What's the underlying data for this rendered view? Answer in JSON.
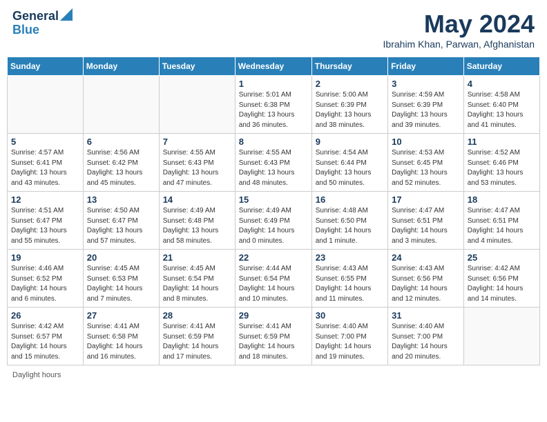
{
  "header": {
    "logo_line1": "General",
    "logo_line2": "Blue",
    "month_title": "May 2024",
    "subtitle": "Ibrahim Khan, Parwan, Afghanistan"
  },
  "calendar": {
    "days_of_week": [
      "Sunday",
      "Monday",
      "Tuesday",
      "Wednesday",
      "Thursday",
      "Friday",
      "Saturday"
    ],
    "weeks": [
      [
        {
          "day": "",
          "info": ""
        },
        {
          "day": "",
          "info": ""
        },
        {
          "day": "",
          "info": ""
        },
        {
          "day": "1",
          "info": "Sunrise: 5:01 AM\nSunset: 6:38 PM\nDaylight: 13 hours\nand 36 minutes."
        },
        {
          "day": "2",
          "info": "Sunrise: 5:00 AM\nSunset: 6:39 PM\nDaylight: 13 hours\nand 38 minutes."
        },
        {
          "day": "3",
          "info": "Sunrise: 4:59 AM\nSunset: 6:39 PM\nDaylight: 13 hours\nand 39 minutes."
        },
        {
          "day": "4",
          "info": "Sunrise: 4:58 AM\nSunset: 6:40 PM\nDaylight: 13 hours\nand 41 minutes."
        }
      ],
      [
        {
          "day": "5",
          "info": "Sunrise: 4:57 AM\nSunset: 6:41 PM\nDaylight: 13 hours\nand 43 minutes."
        },
        {
          "day": "6",
          "info": "Sunrise: 4:56 AM\nSunset: 6:42 PM\nDaylight: 13 hours\nand 45 minutes."
        },
        {
          "day": "7",
          "info": "Sunrise: 4:55 AM\nSunset: 6:43 PM\nDaylight: 13 hours\nand 47 minutes."
        },
        {
          "day": "8",
          "info": "Sunrise: 4:55 AM\nSunset: 6:43 PM\nDaylight: 13 hours\nand 48 minutes."
        },
        {
          "day": "9",
          "info": "Sunrise: 4:54 AM\nSunset: 6:44 PM\nDaylight: 13 hours\nand 50 minutes."
        },
        {
          "day": "10",
          "info": "Sunrise: 4:53 AM\nSunset: 6:45 PM\nDaylight: 13 hours\nand 52 minutes."
        },
        {
          "day": "11",
          "info": "Sunrise: 4:52 AM\nSunset: 6:46 PM\nDaylight: 13 hours\nand 53 minutes."
        }
      ],
      [
        {
          "day": "12",
          "info": "Sunrise: 4:51 AM\nSunset: 6:47 PM\nDaylight: 13 hours\nand 55 minutes."
        },
        {
          "day": "13",
          "info": "Sunrise: 4:50 AM\nSunset: 6:47 PM\nDaylight: 13 hours\nand 57 minutes."
        },
        {
          "day": "14",
          "info": "Sunrise: 4:49 AM\nSunset: 6:48 PM\nDaylight: 13 hours\nand 58 minutes."
        },
        {
          "day": "15",
          "info": "Sunrise: 4:49 AM\nSunset: 6:49 PM\nDaylight: 14 hours\nand 0 minutes."
        },
        {
          "day": "16",
          "info": "Sunrise: 4:48 AM\nSunset: 6:50 PM\nDaylight: 14 hours\nand 1 minute."
        },
        {
          "day": "17",
          "info": "Sunrise: 4:47 AM\nSunset: 6:51 PM\nDaylight: 14 hours\nand 3 minutes."
        },
        {
          "day": "18",
          "info": "Sunrise: 4:47 AM\nSunset: 6:51 PM\nDaylight: 14 hours\nand 4 minutes."
        }
      ],
      [
        {
          "day": "19",
          "info": "Sunrise: 4:46 AM\nSunset: 6:52 PM\nDaylight: 14 hours\nand 6 minutes."
        },
        {
          "day": "20",
          "info": "Sunrise: 4:45 AM\nSunset: 6:53 PM\nDaylight: 14 hours\nand 7 minutes."
        },
        {
          "day": "21",
          "info": "Sunrise: 4:45 AM\nSunset: 6:54 PM\nDaylight: 14 hours\nand 8 minutes."
        },
        {
          "day": "22",
          "info": "Sunrise: 4:44 AM\nSunset: 6:54 PM\nDaylight: 14 hours\nand 10 minutes."
        },
        {
          "day": "23",
          "info": "Sunrise: 4:43 AM\nSunset: 6:55 PM\nDaylight: 14 hours\nand 11 minutes."
        },
        {
          "day": "24",
          "info": "Sunrise: 4:43 AM\nSunset: 6:56 PM\nDaylight: 14 hours\nand 12 minutes."
        },
        {
          "day": "25",
          "info": "Sunrise: 4:42 AM\nSunset: 6:56 PM\nDaylight: 14 hours\nand 14 minutes."
        }
      ],
      [
        {
          "day": "26",
          "info": "Sunrise: 4:42 AM\nSunset: 6:57 PM\nDaylight: 14 hours\nand 15 minutes."
        },
        {
          "day": "27",
          "info": "Sunrise: 4:41 AM\nSunset: 6:58 PM\nDaylight: 14 hours\nand 16 minutes."
        },
        {
          "day": "28",
          "info": "Sunrise: 4:41 AM\nSunset: 6:59 PM\nDaylight: 14 hours\nand 17 minutes."
        },
        {
          "day": "29",
          "info": "Sunrise: 4:41 AM\nSunset: 6:59 PM\nDaylight: 14 hours\nand 18 minutes."
        },
        {
          "day": "30",
          "info": "Sunrise: 4:40 AM\nSunset: 7:00 PM\nDaylight: 14 hours\nand 19 minutes."
        },
        {
          "day": "31",
          "info": "Sunrise: 4:40 AM\nSunset: 7:00 PM\nDaylight: 14 hours\nand 20 minutes."
        },
        {
          "day": "",
          "info": ""
        }
      ]
    ]
  },
  "footer": {
    "text": "Daylight hours"
  }
}
